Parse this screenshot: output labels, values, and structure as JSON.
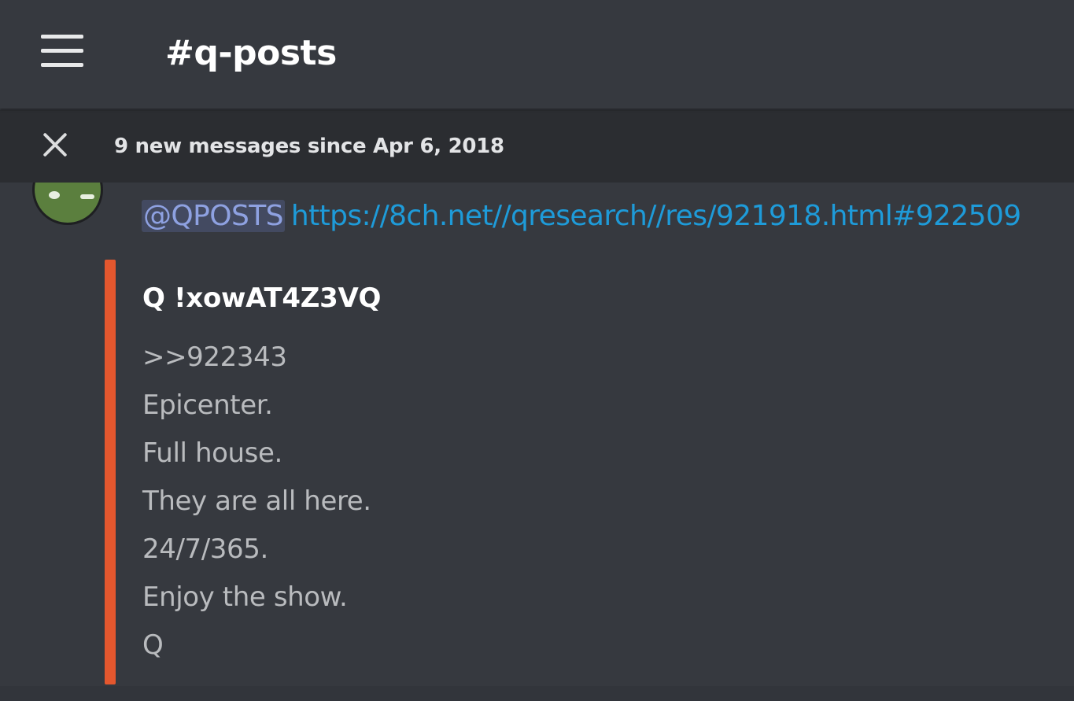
{
  "header": {
    "channel_name": "#q-posts"
  },
  "banner": {
    "text": "9 new messages since Apr 6, 2018"
  },
  "message": {
    "mention": "@QPOSTS",
    "link": "https://8ch.net//qresearch//res/921918.html#922509"
  },
  "embed": {
    "author": "Q !xowAT4Z3VQ",
    "lines": [
      ">>922343",
      "Epicenter.",
      "Full house.",
      "They are all here.",
      "24/7/365.",
      "Enjoy the show.",
      "Q"
    ],
    "accent_color": "#e4572e"
  },
  "colors": {
    "background": "#36393f",
    "banner": "#2b2d31",
    "link": "#1e9bd9",
    "mention": "#8ea1e1"
  }
}
